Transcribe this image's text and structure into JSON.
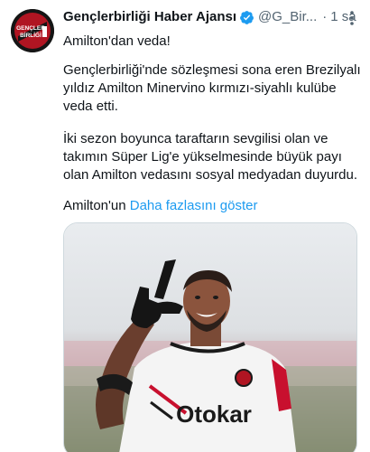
{
  "account": {
    "display_name": "Gençlerbirliği Haber Ajansı",
    "handle": "@G_Bir...",
    "separator": "·",
    "time": "1 sa",
    "avatar_text_top": "GENÇLER",
    "avatar_text_bottom": "BİRLİĞİ",
    "verified": true
  },
  "tweet": {
    "line1": "Amilton'dan veda!",
    "para2": "Gençlerbirliği'nde sözleşmesi sona eren Brezilyalı yıldız Amilton Minervino kırmızı-siyahlı kulübe veda etti.",
    "para3": "İki sezon boyunca taraftarın sevgilisi olan ve takımın Süper Lig'e yükselmesinde büyük payı olan Amilton vedasını sosyal medyadan duyurdu.",
    "para4_prefix": "Amilton'un ",
    "show_more": "Daha fazlasını göster"
  },
  "media": {
    "jersey_text": "Otokar"
  },
  "icons": {
    "verified": "verified-badge-icon",
    "more": "more-options-icon"
  },
  "colors": {
    "accent": "#1d9bf0",
    "text": "#0f1419",
    "muted": "#536471"
  }
}
